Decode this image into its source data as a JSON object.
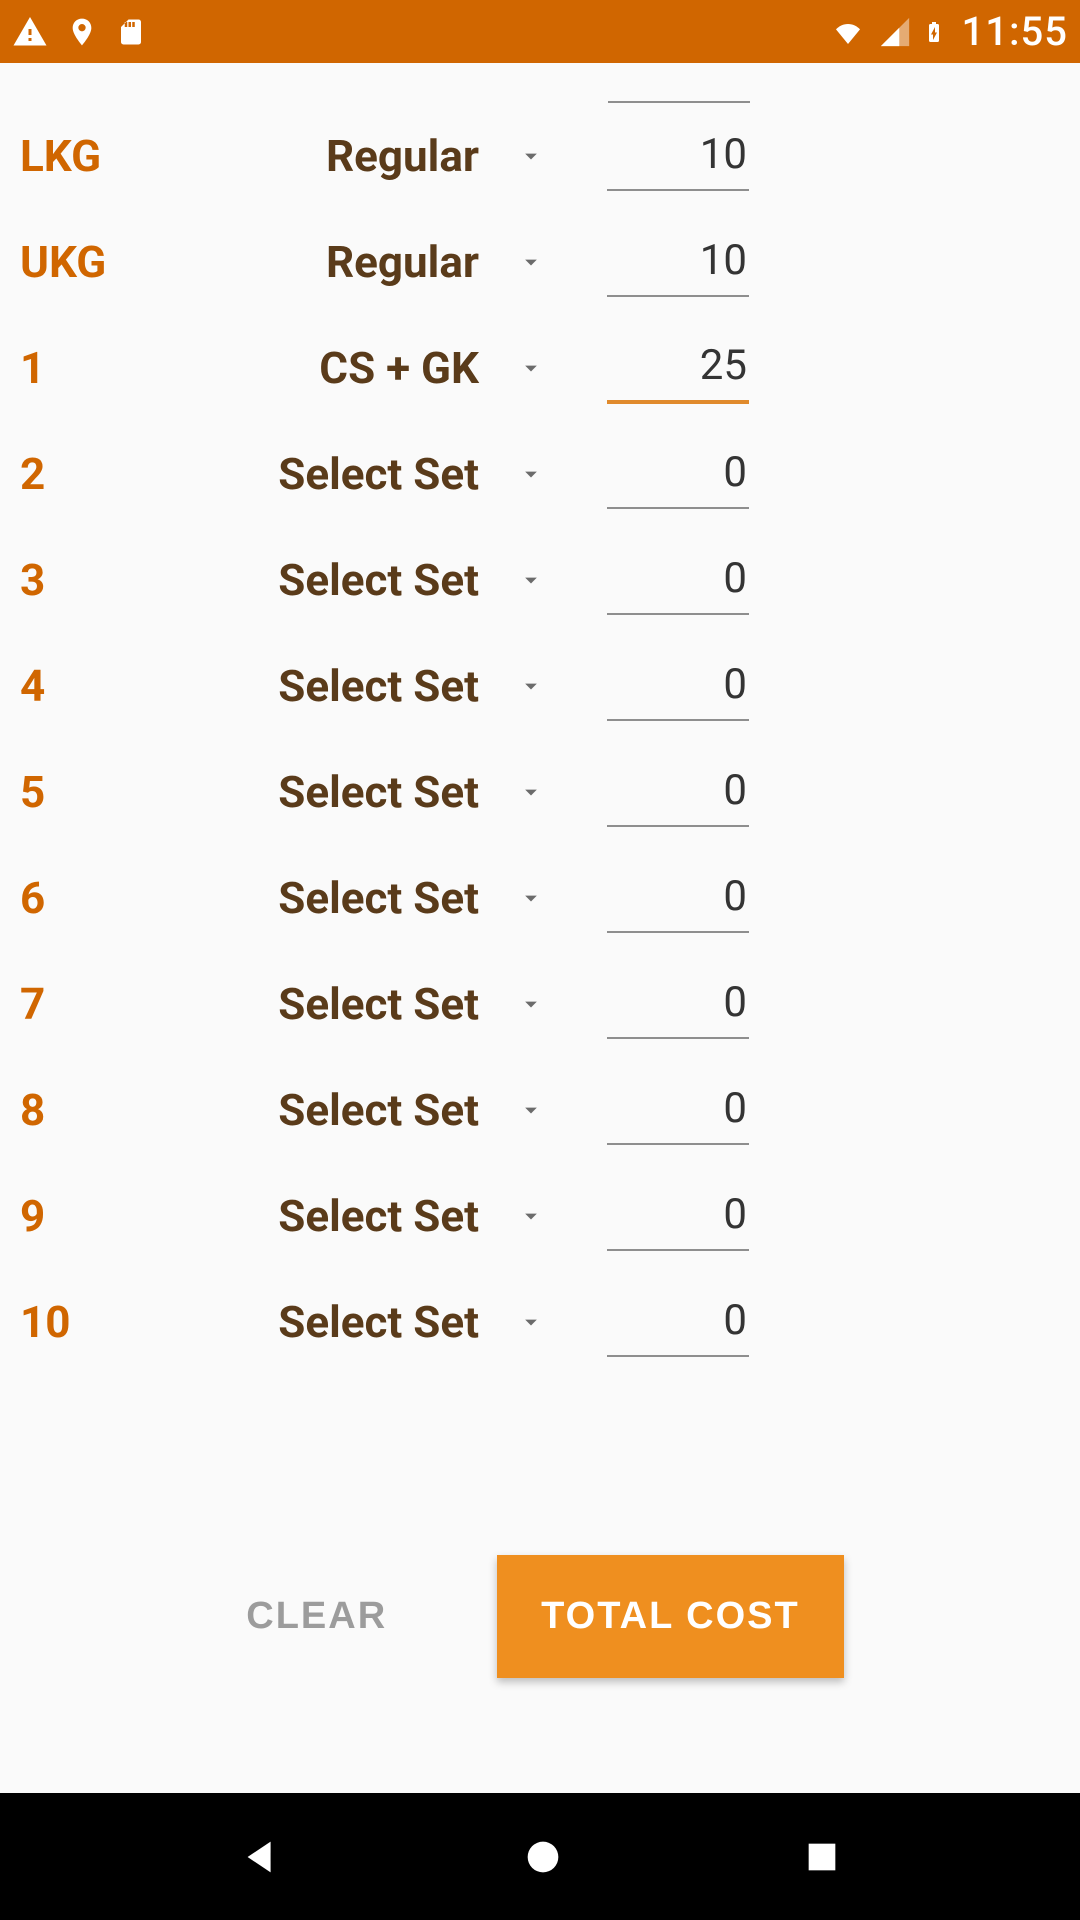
{
  "statusbar": {
    "time": "11:55",
    "icons": {
      "warning": "warning-icon",
      "location": "location-icon",
      "sd": "sd-card-icon",
      "wifi": "wifi-icon",
      "cell": "cell-signal-icon",
      "battery": "battery-charging-icon"
    }
  },
  "rows": [
    {
      "class": "LKG",
      "set": "Regular",
      "qty": "10",
      "focused": false
    },
    {
      "class": "UKG",
      "set": "Regular",
      "qty": "10",
      "focused": false
    },
    {
      "class": "1",
      "set": "CS + GK",
      "qty": "25",
      "focused": true
    },
    {
      "class": "2",
      "set": "Select Set",
      "qty": "0",
      "focused": false
    },
    {
      "class": "3",
      "set": "Select Set",
      "qty": "0",
      "focused": false
    },
    {
      "class": "4",
      "set": "Select Set",
      "qty": "0",
      "focused": false
    },
    {
      "class": "5",
      "set": "Select Set",
      "qty": "0",
      "focused": false
    },
    {
      "class": "6",
      "set": "Select Set",
      "qty": "0",
      "focused": false
    },
    {
      "class": "7",
      "set": "Select Set",
      "qty": "0",
      "focused": false
    },
    {
      "class": "8",
      "set": "Select Set",
      "qty": "0",
      "focused": false
    },
    {
      "class": "9",
      "set": "Select Set",
      "qty": "0",
      "focused": false
    },
    {
      "class": "10",
      "set": "Select Set",
      "qty": "0",
      "focused": false
    }
  ],
  "buttons": {
    "clear": "CLEAR",
    "total_cost": "TOTAL COST"
  }
}
